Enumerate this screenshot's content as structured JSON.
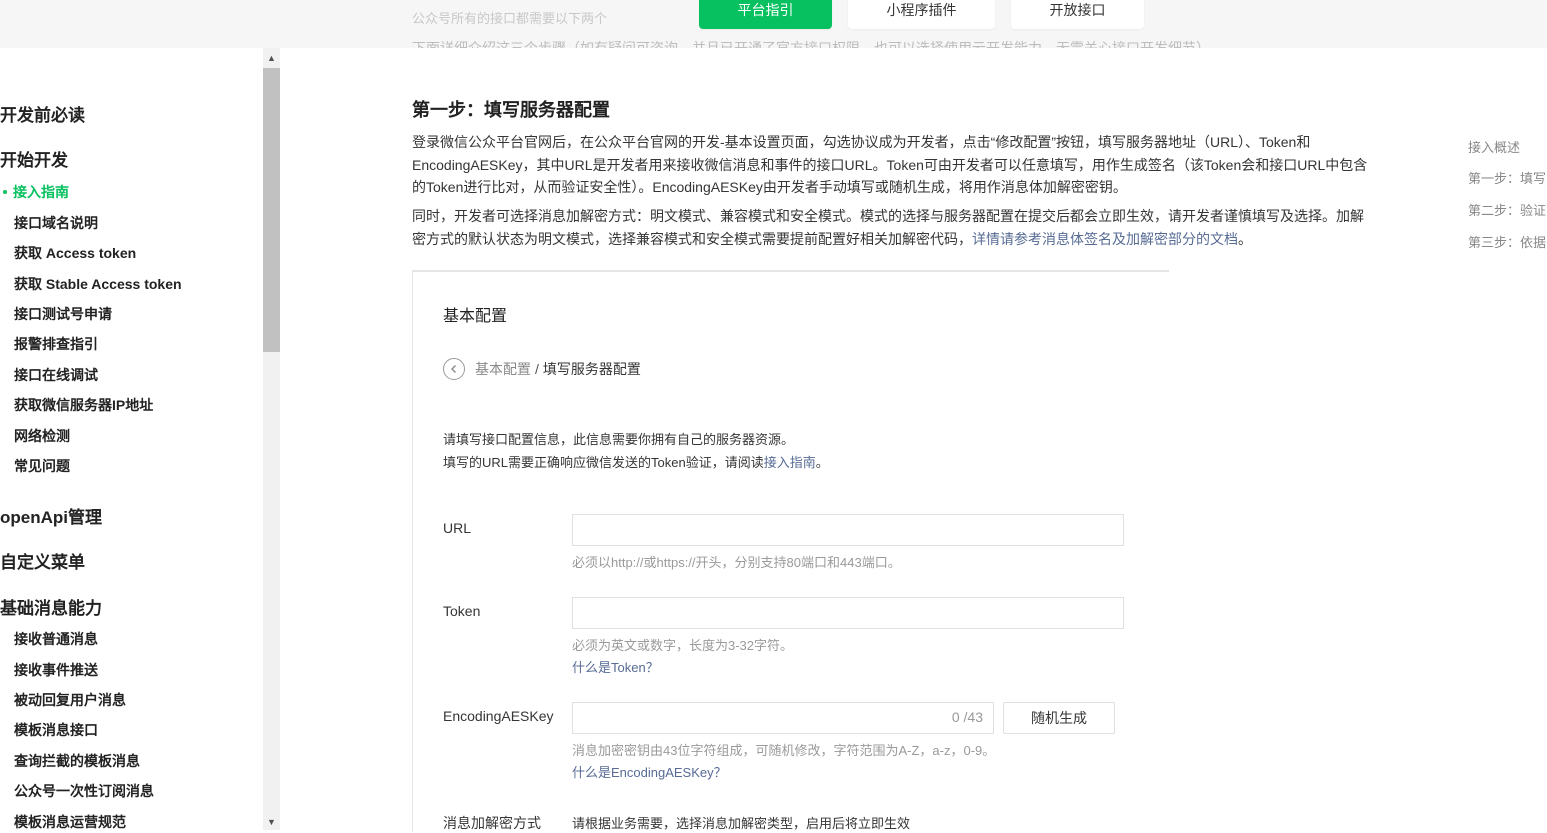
{
  "topbar": {
    "faded_text": "公众号所有的接口都需要以下两个",
    "faded_text2": "下面详细介绍这三个步骤（如有疑问可咨询，并且已开通了官方接口权限，也可以选择使用云开发能力，无需关心接口开发细节）",
    "nav": [
      "平台指引",
      "小程序插件",
      "开放接口"
    ]
  },
  "sidebar": {
    "groups": {
      "g1": "开发前必读",
      "g2": "开始开发",
      "g3": "openApi管理",
      "g4": "自定义菜单",
      "g5": "基础消息能力"
    },
    "start_items": [
      "接入指南",
      "接口域名说明",
      "获取 Access token",
      "获取 Stable Access token",
      "接口测试号申请",
      "报警排查指引",
      "接口在线调试",
      "获取微信服务器IP地址",
      "网络检测",
      "常见问题"
    ],
    "msg_items": [
      "接收普通消息",
      "接收事件推送",
      "被动回复用户消息",
      "模板消息接口",
      "查询拦截的模板消息",
      "公众号一次性订阅消息",
      "模板消息运营规范"
    ]
  },
  "main": {
    "heading": "第一步：填写服务器配置",
    "p1": "登录微信公众平台官网后，在公众平台官网的开发-基本设置页面，勾选协议成为开发者，点击“修改配置”按钮，填写服务器地址（URL）、Token和EncodingAESKey，其中URL是开发者用来接收微信消息和事件的接口URL。Token可由开发者可以任意填写，用作生成签名（该Token会和接口URL中包含的Token进行比对，从而验证安全性）。EncodingAESKey由开发者手动填写或随机生成，将用作消息体加解密密钥。",
    "p2_text": "同时，开发者可选择消息加解密方式：明文模式、兼容模式和安全模式。模式的选择与服务器配置在提交后都会立即生效，请开发者谨慎填写及选择。加解密方式的默认状态为明文模式，选择兼容模式和安全模式需要提前配置好相关加解密代码，",
    "p2_link": "详情请参考消息体签名及加解密部分的文档",
    "p2_end": "。"
  },
  "card": {
    "title": "基本配置",
    "crumb1": "基本配置",
    "crumb_sep": "/",
    "crumb2": "填写服务器配置",
    "info1": "请填写接口配置信息，此信息需要你拥有自己的服务器资源。",
    "info2_text": "填写的URL需要正确响应微信发送的Token验证，请阅读",
    "info2_link": "接入指南",
    "info2_end": "。",
    "url_label": "URL",
    "url_tip": "必须以http://或https://开头，分别支持80端口和443端口。",
    "token_label": "Token",
    "token_tip": "必须为英文或数字，长度为3-32字符。",
    "token_link": "什么是Token？",
    "aes_label": "EncodingAESKey",
    "aes_counter": "0 /43",
    "aes_button": "随机生成",
    "aes_tip": "消息加密密钥由43位字符组成，可随机修改，字符范围为A-Z，a-z，0-9。",
    "aes_link": "什么是EncodingAESKey？",
    "mode_label": "消息加解密方式",
    "mode_tip": "请根据业务需要，选择消息加解密类型，启用后将立即生效"
  },
  "toc": [
    "接入概述",
    "第一步：填写",
    "第二步：验证",
    "第三步：依据"
  ]
}
